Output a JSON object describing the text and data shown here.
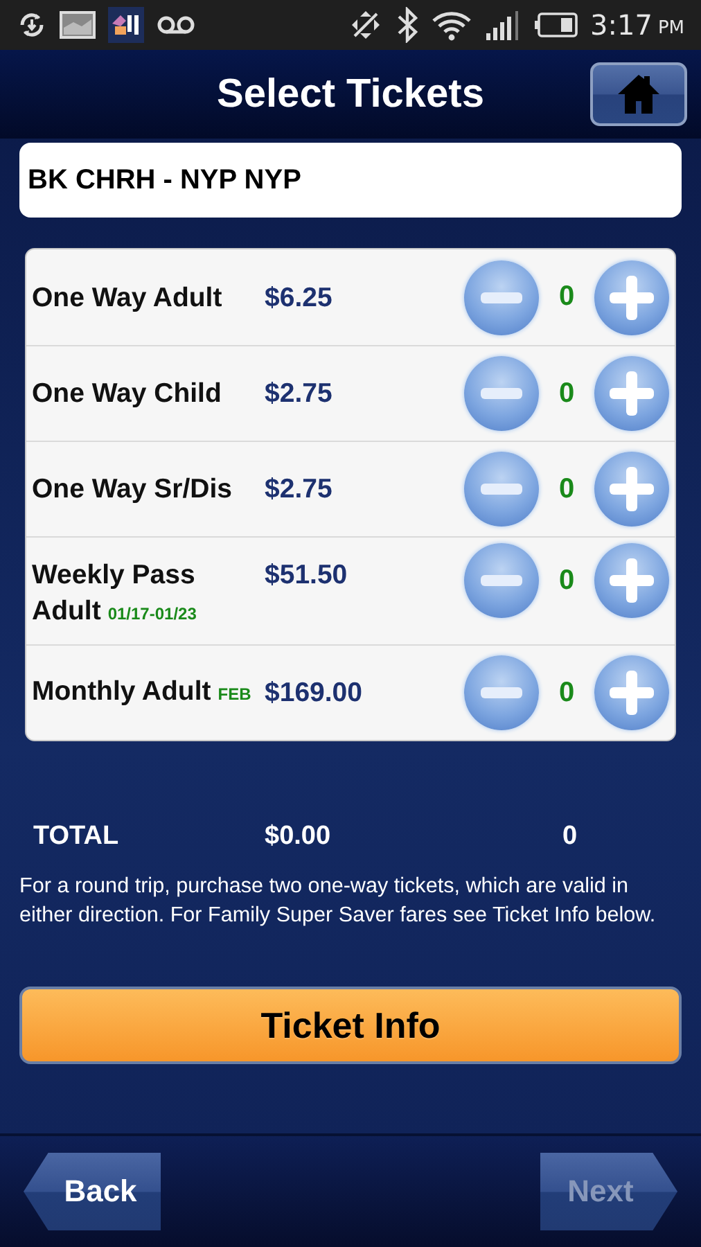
{
  "status_bar": {
    "time": "3:17",
    "period": "PM"
  },
  "header": {
    "title": "Select Tickets"
  },
  "route": {
    "value": "BK CHRH - NYP NYP"
  },
  "tickets": [
    {
      "name": "One Way Adult",
      "price": "$6.25",
      "count": "0"
    },
    {
      "name": "One Way Child",
      "price": "$2.75",
      "count": "0"
    },
    {
      "name": "One Way Sr/Dis",
      "price": "$2.75",
      "count": "0"
    },
    {
      "name": "Weekly Pass Adult",
      "note": "01/17-01/23",
      "price": "$51.50",
      "count": "0"
    },
    {
      "name": "Monthly Adult",
      "note": "FEB",
      "price": "$169.00",
      "count": "0"
    }
  ],
  "total": {
    "label": "TOTAL",
    "amount": "$0.00",
    "count": "0"
  },
  "info_text": "For a round trip, purchase two one-way tickets, which are valid in either direction. For Family Super Saver fares see Ticket Info below.",
  "info_button": "Ticket Info",
  "nav": [
    {
      "label": "Back",
      "kind": "back",
      "disabled": false
    },
    {
      "label": "Next",
      "kind": "next",
      "disabled": true
    }
  ]
}
